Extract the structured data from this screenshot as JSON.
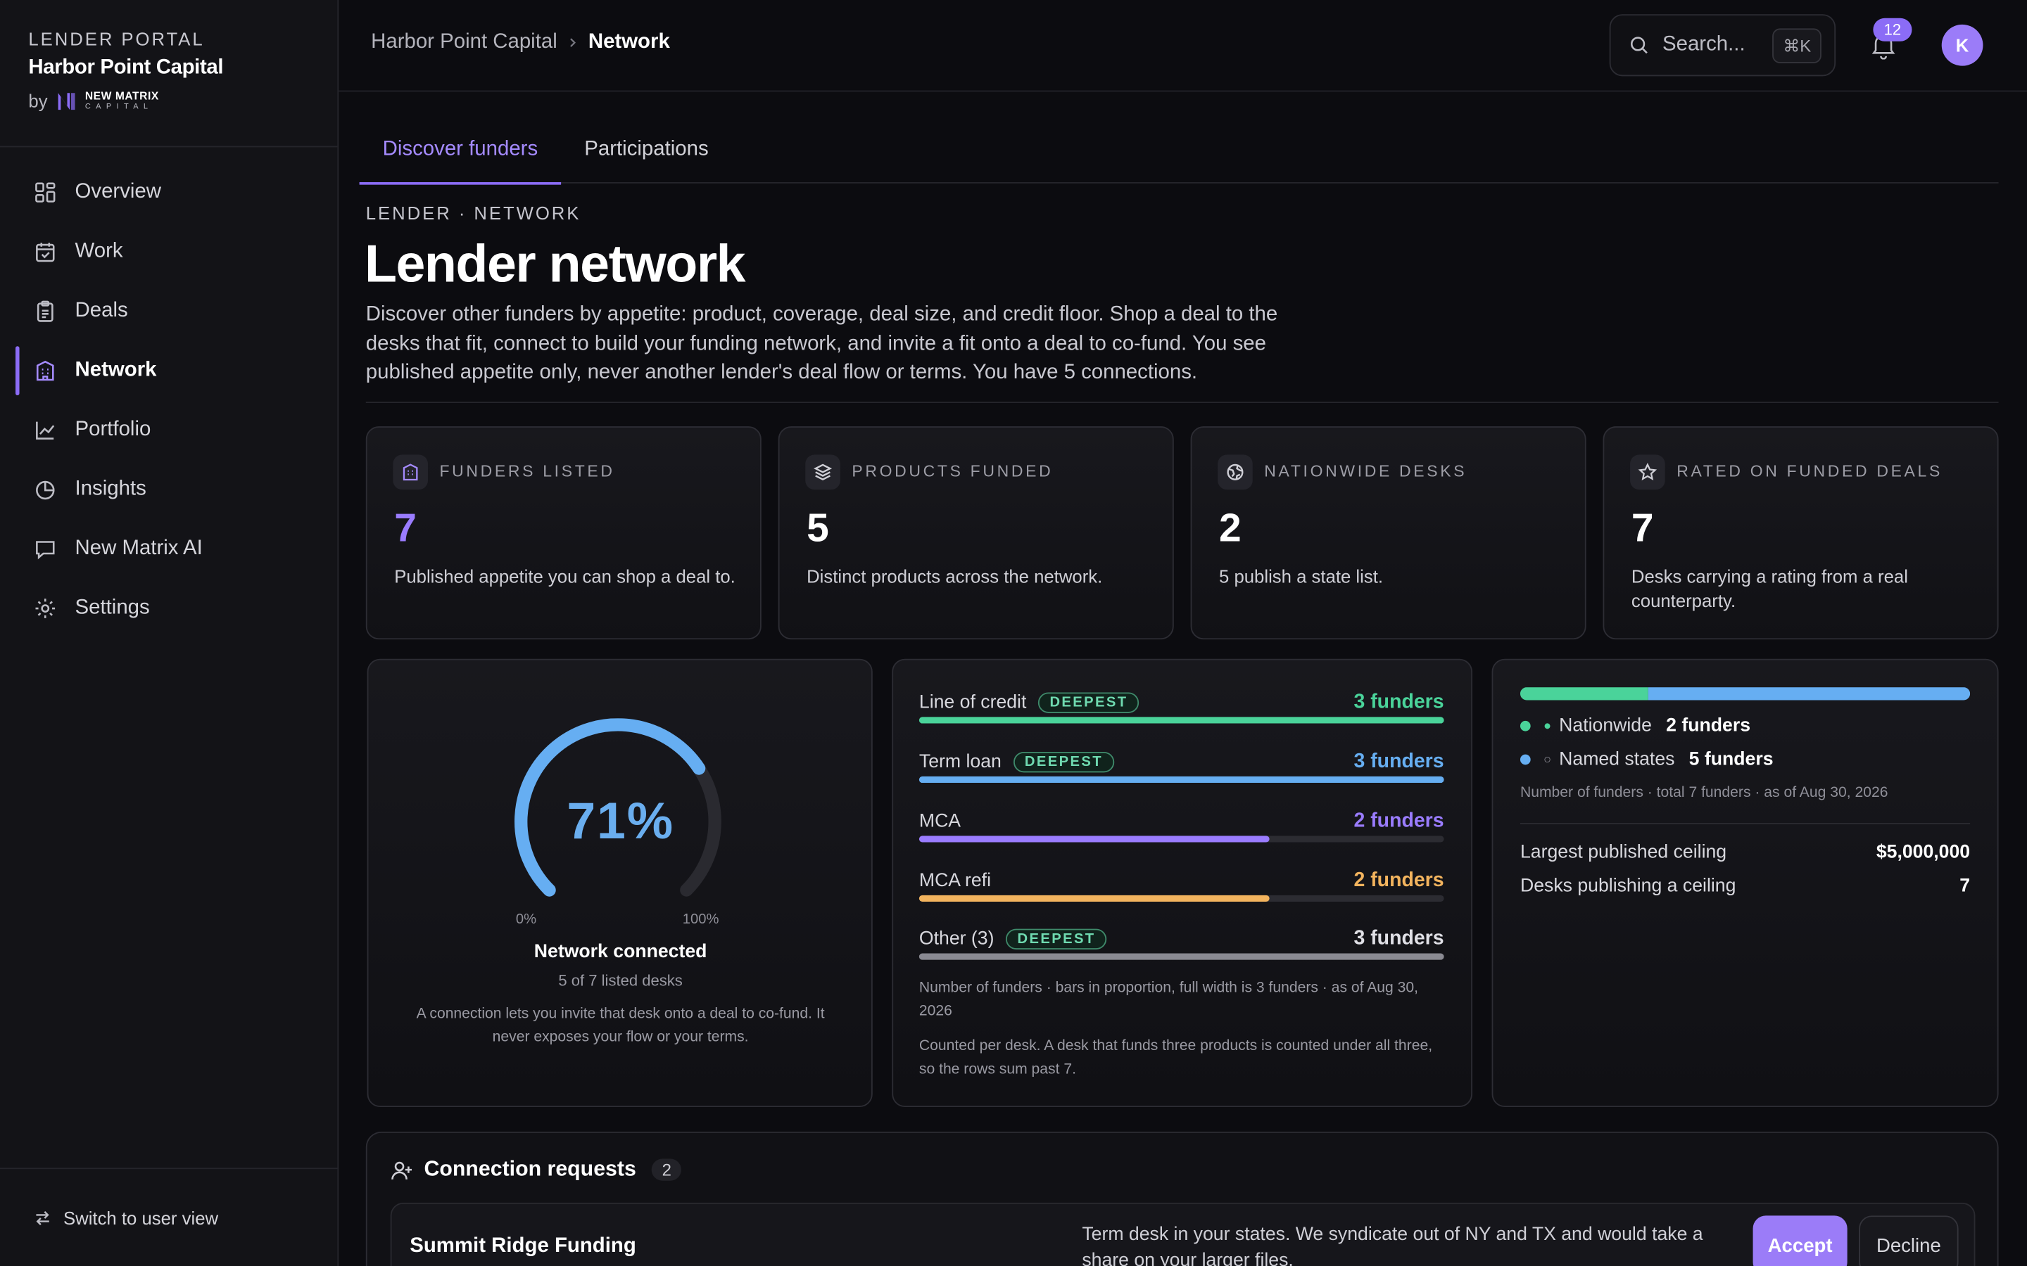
{
  "sidebar": {
    "eyebrow": "LENDER PORTAL",
    "org_name": "Harbor Point Capital",
    "by_label": "by",
    "logo_line1": "NEW MATRIX",
    "logo_line2": "CAPITAL",
    "items": [
      {
        "label": "Overview",
        "icon": "grid-icon"
      },
      {
        "label": "Work",
        "icon": "calendar-check-icon"
      },
      {
        "label": "Deals",
        "icon": "clipboard-icon"
      },
      {
        "label": "Network",
        "icon": "building-icon",
        "active": true
      },
      {
        "label": "Portfolio",
        "icon": "line-chart-icon"
      },
      {
        "label": "Insights",
        "icon": "pie-chart-icon"
      },
      {
        "label": "New Matrix AI",
        "icon": "message-icon"
      },
      {
        "label": "Settings",
        "icon": "gear-icon"
      }
    ],
    "switch_label": "Switch to user view"
  },
  "header": {
    "breadcrumb": [
      "Harbor Point Capital",
      "Network"
    ],
    "search_placeholder": "Search...",
    "search_shortcut": "⌘K",
    "notification_count": "12",
    "avatar_initial": "K"
  },
  "tabs": [
    "Discover funders",
    "Participations"
  ],
  "page": {
    "eyebrow": "LENDER · NETWORK",
    "title": "Lender network",
    "description": "Discover other funders by appetite: product, coverage, deal size, and credit floor. Shop a deal to the desks that fit, connect to build your funding network, and invite a fit onto a deal to co-fund. You see published appetite only, never another lender's deal flow or terms. You have 5 connections."
  },
  "stats": [
    {
      "label": "FUNDERS LISTED",
      "value": "7",
      "sub": "Published appetite you can shop a deal to.",
      "icon": "building-icon"
    },
    {
      "label": "PRODUCTS FUNDED",
      "value": "5",
      "sub": "Distinct products across the network.",
      "icon": "layers-icon"
    },
    {
      "label": "NATIONWIDE DESKS",
      "value": "2",
      "sub": "5 publish a state list.",
      "icon": "globe-icon"
    },
    {
      "label": "RATED ON FUNDED DEALS",
      "value": "7",
      "sub": "Desks carrying a rating from a real counterparty.",
      "icon": "star-icon"
    }
  ],
  "gauge": {
    "percent": 71,
    "percent_label": "71%",
    "min_label": "0%",
    "max_label": "100%",
    "title": "Network connected",
    "sub": "5 of 7 listed desks",
    "note": "A connection lets you invite that desk onto a deal to co-fund. It never exposes your flow or your terms."
  },
  "products": {
    "max": 3,
    "deepest_label": "DEEPEST",
    "rows": [
      {
        "label": "Line of credit",
        "count": 3,
        "count_label": "3 funders",
        "deepest": true,
        "color": "#4ad39a"
      },
      {
        "label": "Term loan",
        "count": 3,
        "count_label": "3 funders",
        "deepest": true,
        "color": "#66aef2"
      },
      {
        "label": "MCA",
        "count": 2,
        "count_label": "2 funders",
        "deepest": false,
        "color": "#9a7cff"
      },
      {
        "label": "MCA refi",
        "count": 2,
        "count_label": "2 funders",
        "deepest": false,
        "color": "#f3b45e"
      },
      {
        "label": "Other (3)",
        "count": 3,
        "count_label": "3 funders",
        "deepest": true,
        "color": "#8a8a92"
      }
    ],
    "note1": "Number of funders · bars in proportion, full width is 3 funders · as of Aug 30, 2026",
    "note2": "Counted per desk. A desk that funds three products is counted under all three, so the rows sum past 7."
  },
  "coverage": {
    "segments": [
      {
        "label": "Nationwide",
        "value": 2,
        "value_label": "2 funders",
        "color": "#4ad39a",
        "marker": "●"
      },
      {
        "label": "Named states",
        "value": 5,
        "value_label": "5 funders",
        "color": "#66aef2",
        "marker": "○"
      }
    ],
    "note": "Number of funders · total 7 funders · as of Aug 30, 2026",
    "kv": [
      {
        "label": "Largest published ceiling",
        "value": "$5,000,000"
      },
      {
        "label": "Desks publishing a ceiling",
        "value": "7"
      }
    ]
  },
  "requests": {
    "title": "Connection requests",
    "count": "2",
    "items": [
      {
        "name": "Summit Ridge Funding",
        "message": "Term desk in your states. We syndicate out of NY and TX and would take a share on your larger files.",
        "accept": "Accept",
        "decline": "Decline"
      }
    ]
  }
}
